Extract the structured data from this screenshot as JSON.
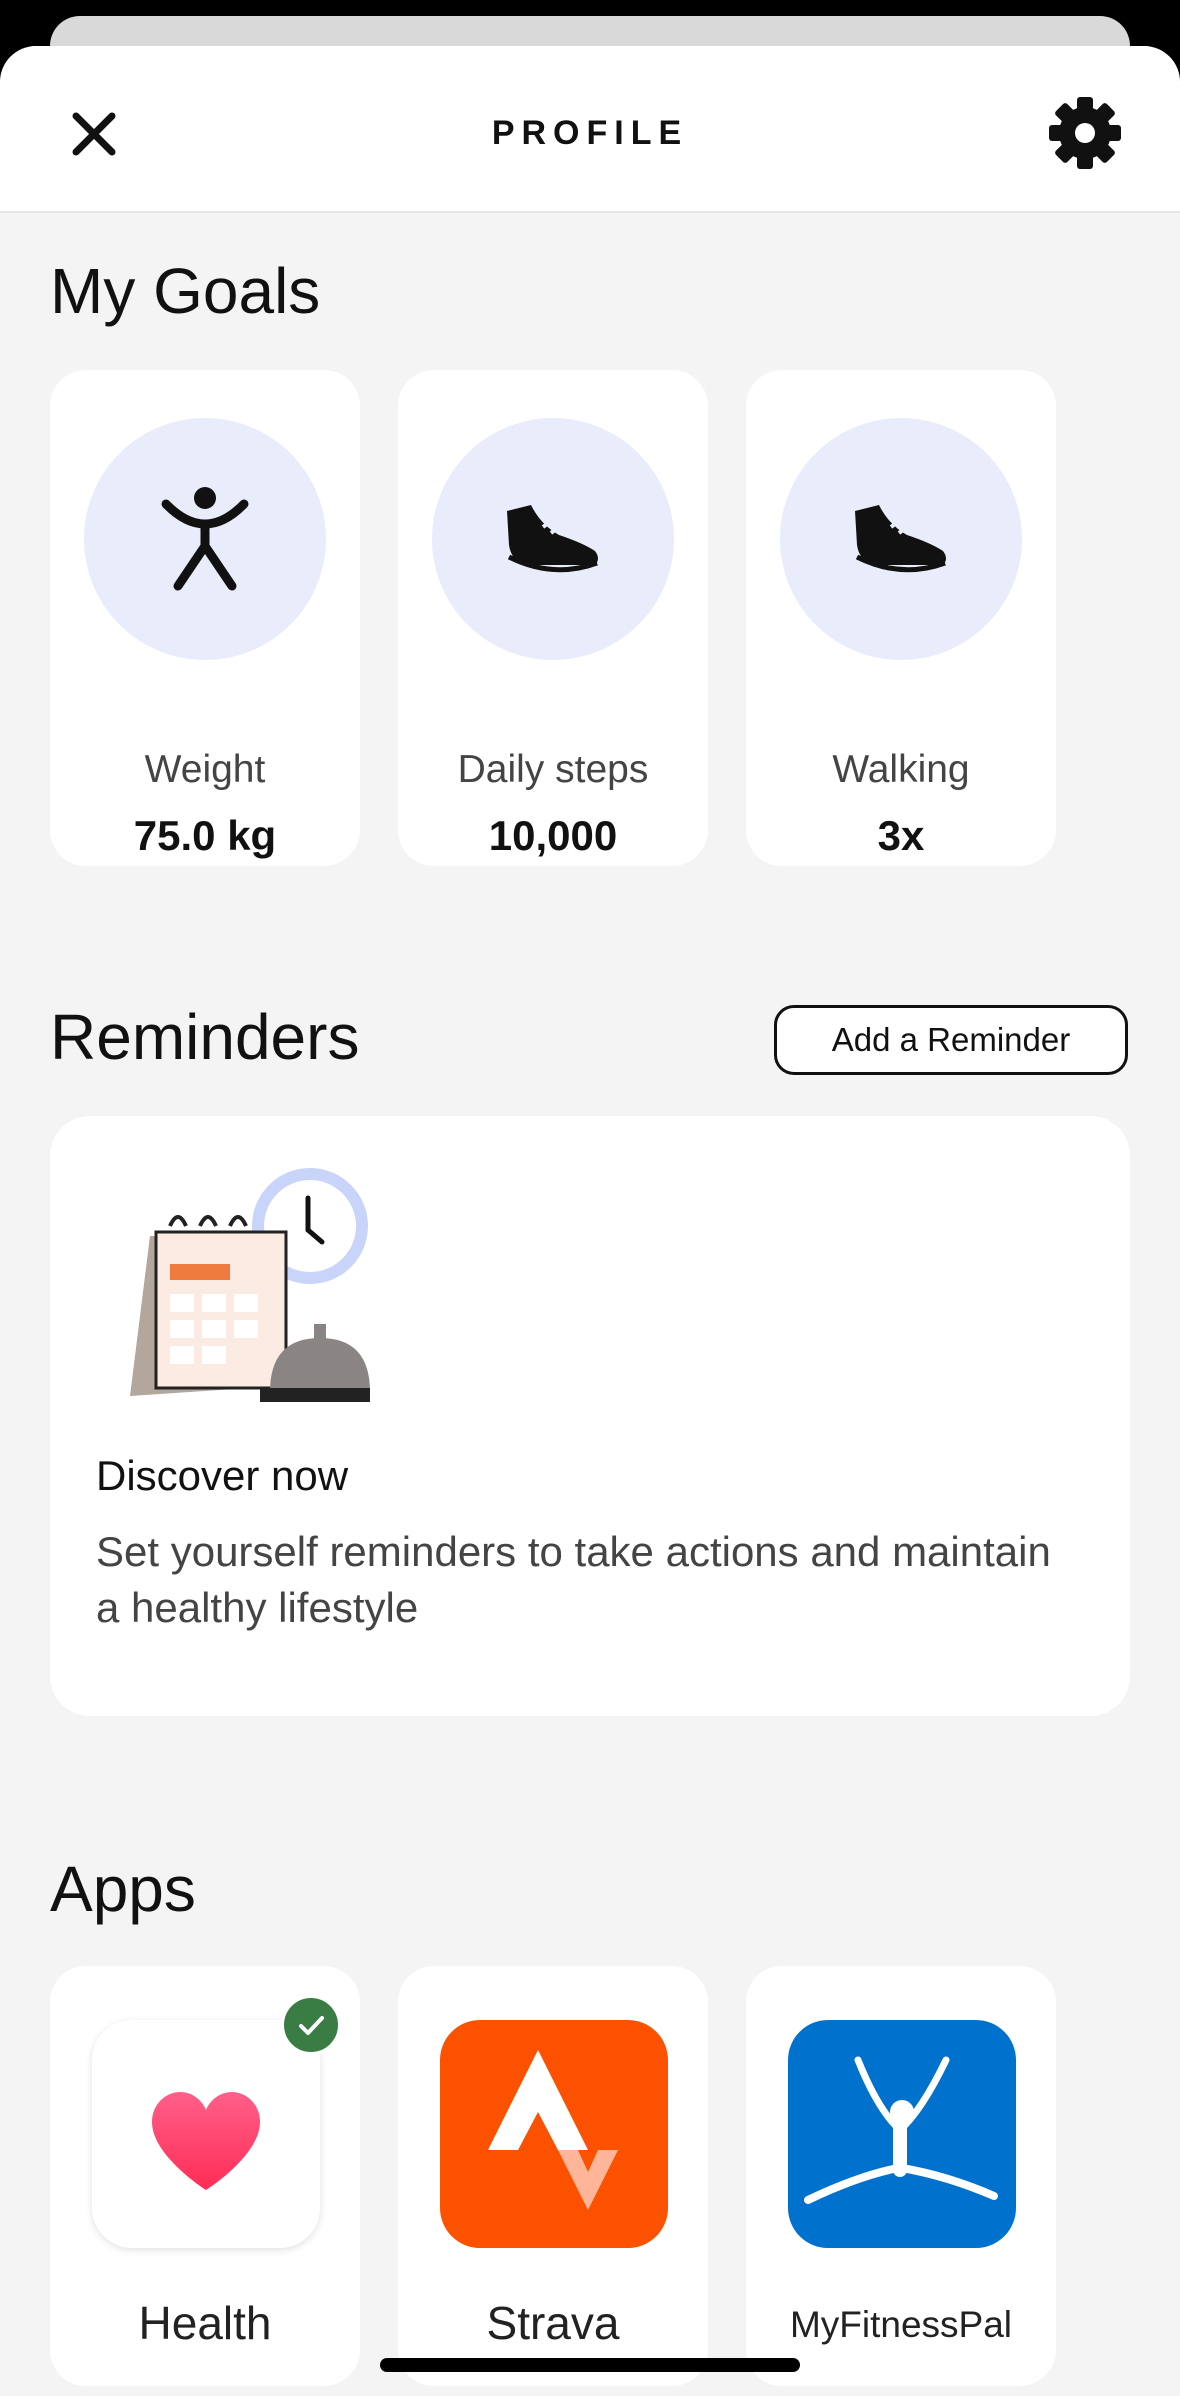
{
  "header": {
    "title": "PROFILE"
  },
  "goals": {
    "title": "My Goals",
    "items": [
      {
        "icon": "person-icon",
        "label": "Weight",
        "value": "75.0 kg"
      },
      {
        "icon": "shoe-icon",
        "label": "Daily steps",
        "value": "10,000"
      },
      {
        "icon": "shoe-icon",
        "label": "Walking",
        "value": "3x"
      }
    ]
  },
  "reminders": {
    "title": "Reminders",
    "add_label": "Add a Reminder",
    "card": {
      "title": "Discover now",
      "description": "Set yourself reminders to take actions and maintain a healthy lifestyle"
    }
  },
  "apps": {
    "title": "Apps",
    "items": [
      {
        "name": "Health",
        "icon": "heart-icon",
        "connected": true
      },
      {
        "name": "Strava",
        "icon": "strava-icon",
        "connected": false
      },
      {
        "name": "MyFitnessPal",
        "icon": "myfitnesspal-icon",
        "connected": false
      }
    ]
  },
  "colors": {
    "accent_circle": "#e8ecfb",
    "strava": "#fc5200",
    "mfp": "#0072ce",
    "check": "#3a7d44"
  }
}
